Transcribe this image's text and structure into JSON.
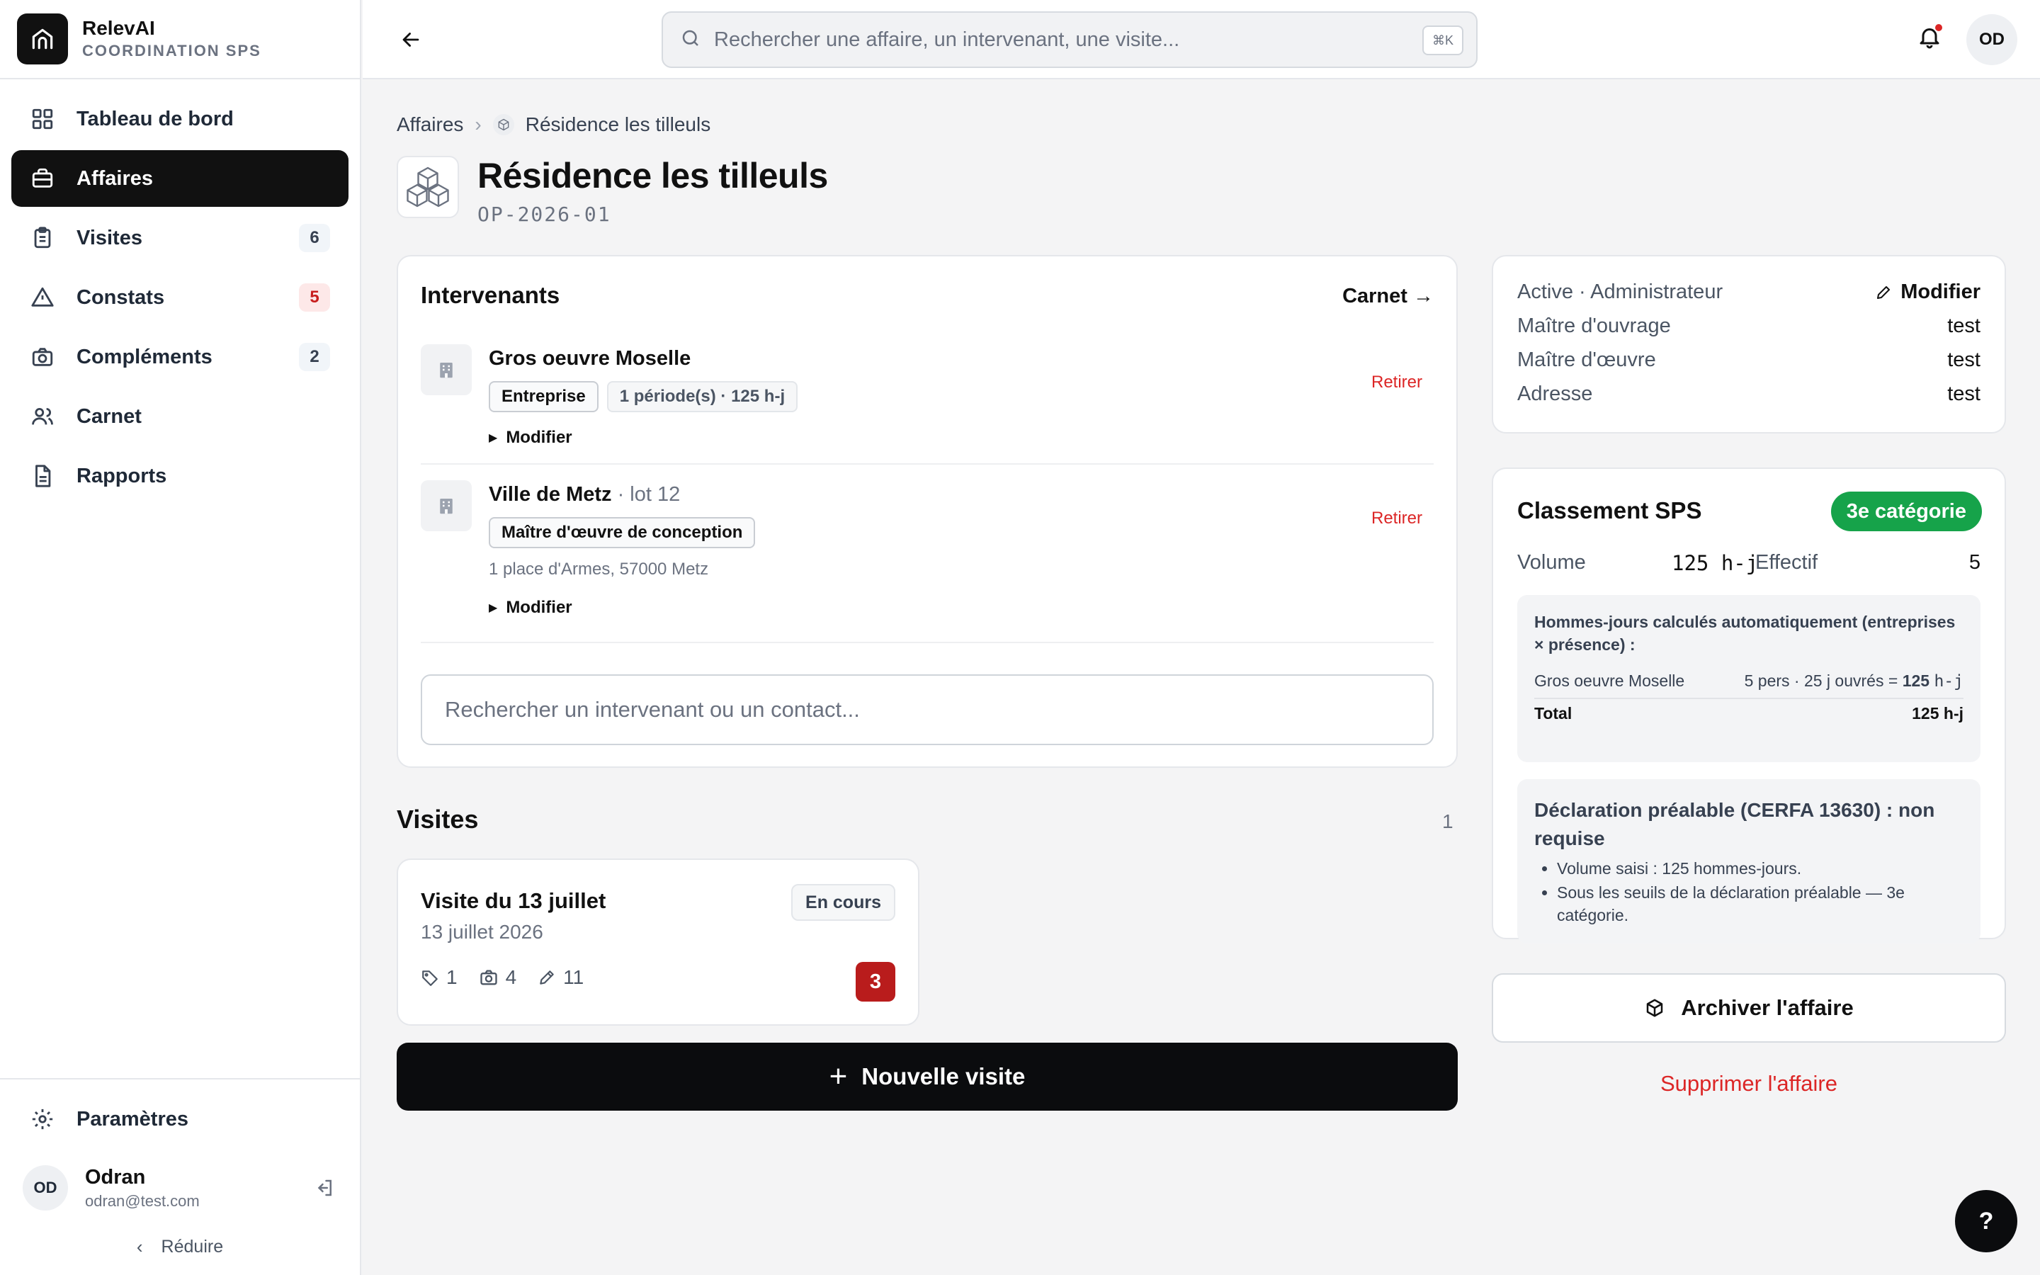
{
  "brand": {
    "name": "RelevAI",
    "subtitle": "COORDINATION SPS"
  },
  "sidebar": {
    "items": [
      {
        "label": "Tableau de bord",
        "icon": "grid-icon",
        "badge": ""
      },
      {
        "label": "Affaires",
        "icon": "briefcase-icon",
        "badge": "",
        "active": true
      },
      {
        "label": "Visites",
        "icon": "clipboard-icon",
        "badge": "6"
      },
      {
        "label": "Constats",
        "icon": "warning-icon",
        "badge": "5",
        "badge_color": "#c81e1e"
      },
      {
        "label": "Compléments",
        "icon": "camera-icon",
        "badge": "2"
      },
      {
        "label": "Carnet",
        "icon": "users-icon",
        "badge": ""
      },
      {
        "label": "Rapports",
        "icon": "document-icon",
        "badge": ""
      }
    ],
    "settings_label": "Paramètres",
    "user": {
      "initials": "OD",
      "name": "Odran",
      "email": "odran@test.com"
    },
    "collapse_label": "Réduire"
  },
  "topbar": {
    "search_placeholder": "Rechercher une affaire, un intervenant, une visite...",
    "shortcut": "⌘K",
    "avatar_initials": "OD"
  },
  "breadcrumb": {
    "root": "Affaires",
    "current": "Résidence les tilleuls"
  },
  "page": {
    "title": "Résidence les tilleuls",
    "code": "OP-2026-01"
  },
  "intervenants": {
    "title": "Intervenants",
    "carnet_link": "Carnet →",
    "items": [
      {
        "name": "Gros oeuvre Moselle",
        "lot": "",
        "tags": [
          "Entreprise",
          "1 période(s) · 125 h-j"
        ],
        "address": "",
        "modify_label": "Modifier",
        "remove_label": "Retirer"
      },
      {
        "name": "Ville de Metz",
        "lot": "· lot 12",
        "tags": [
          "Maître d'œuvre de conception"
        ],
        "address": "1 place d'Armes, 57000 Metz",
        "modify_label": "Modifier",
        "remove_label": "Retirer"
      }
    ],
    "search_placeholder": "Rechercher un intervenant ou un contact..."
  },
  "visites": {
    "title": "Visites",
    "count": "1",
    "items": [
      {
        "title": "Visite du 13 juillet",
        "date": "13 juillet 2026",
        "status": "En cours",
        "tags_count": "1",
        "photos_count": "4",
        "notes_count": "11",
        "alerts_count": "3"
      }
    ],
    "new_label": "Nouvelle visite"
  },
  "info": {
    "status": "Active · Administrateur",
    "modify_label": "Modifier",
    "rows": [
      {
        "key": "Maître d'ouvrage",
        "value": "test"
      },
      {
        "key": "Maître d'œuvre",
        "value": "test"
      },
      {
        "key": "Adresse",
        "value": "test"
      }
    ]
  },
  "sps": {
    "title": "Classement SPS",
    "category": "3e catégorie",
    "category_color": "#16a34a",
    "volume_label": "Volume",
    "volume_value": "125 h-j",
    "effectif_label": "Effectif",
    "effectif_value": "5",
    "calc_heading": "Hommes-jours calculés automatiquement (entreprises × présence) :",
    "calc_rows": [
      {
        "name": "Gros oeuvre Moselle",
        "formula": "5 pers · 25 j ouvrés =",
        "result": "125",
        "unit": "h-j"
      }
    ],
    "total_label": "Total",
    "total_value": "125 h-j",
    "declaration_title": "Déclaration préalable (CERFA 13630) : non requise",
    "declaration_items": [
      "Volume saisi : 125 hommes-jours.",
      "Sous les seuils de la déclaration préalable — 3e catégorie."
    ]
  },
  "actions": {
    "archive_label": "Archiver l'affaire",
    "delete_label": "Supprimer l'affaire",
    "delete_color": "#dc2626"
  },
  "help_label": "?"
}
